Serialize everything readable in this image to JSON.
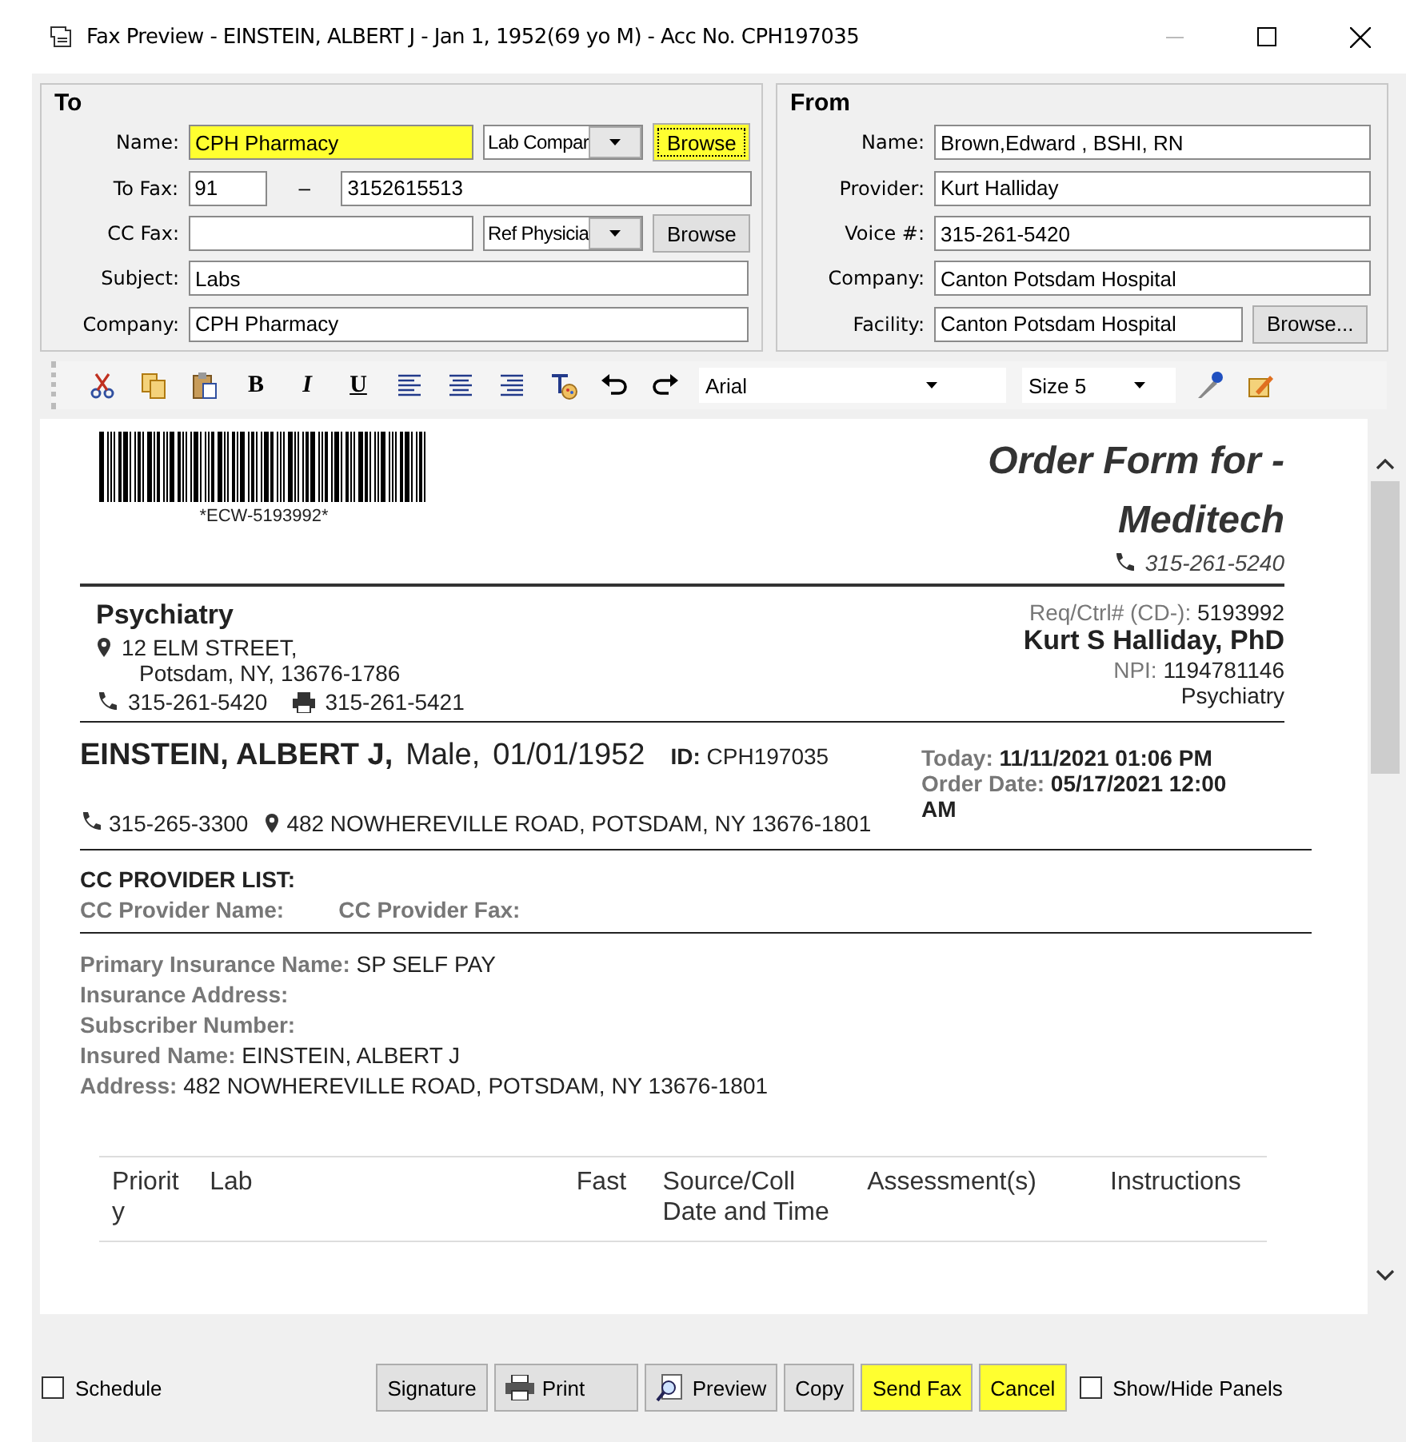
{
  "window": {
    "title": "Fax Preview - EINSTEIN, ALBERT J - Jan 1, 1952(69 yo M) - Acc No. CPH197035"
  },
  "to": {
    "legend": "To",
    "rows": [
      {
        "label": "Name:",
        "parts": [
          {
            "kind": "input",
            "value": "CPH Pharmacy",
            "highlighted": true
          },
          {
            "kind": "select",
            "value": "Lab Compar"
          },
          {
            "kind": "button",
            "label": "Browse",
            "highlighted": true
          }
        ]
      },
      {
        "label": "To Fax:",
        "parts": [
          {
            "kind": "input",
            "value": "91",
            "highlighted": false
          },
          {
            "kind": "dash",
            "text": "–"
          },
          {
            "kind": "input",
            "value": "3152615513",
            "highlighted": false
          }
        ]
      },
      {
        "label": "CC Fax:",
        "parts": [
          {
            "kind": "input",
            "highlighted": false
          },
          {
            "kind": "select",
            "value": "Ref Physicia"
          },
          {
            "kind": "button",
            "label": "Browse",
            "highlighted": false
          }
        ]
      },
      {
        "label": "Subject:",
        "parts": [
          {
            "kind": "input",
            "value": "Labs",
            "highlighted": false
          }
        ]
      },
      {
        "label": "Company:",
        "parts": [
          {
            "kind": "input",
            "value": "CPH Pharmacy",
            "highlighted": false
          }
        ]
      }
    ]
  },
  "from": {
    "legend": "From",
    "rows": [
      {
        "label": "Name:",
        "value": "Brown,Edward , BSHI, RN"
      },
      {
        "label": "Provider:",
        "value": "Kurt Halliday"
      },
      {
        "label": "Voice #:",
        "value": "315-261-5420"
      },
      {
        "label": "Company:",
        "value": "Canton Potsdam Hospital"
      },
      {
        "label": "Facility:",
        "value": "Canton Potsdam Hospital",
        "button": "Browse..."
      }
    ]
  },
  "toolbar": {
    "format_buttons": [
      "B",
      "I",
      "U"
    ],
    "font": "Arial",
    "size": "Size 5"
  },
  "document": {
    "barcode_text": "*ECW-5193992*",
    "title_lines": [
      "Order Form for -",
      "Meditech"
    ],
    "title_phone": "315-261-5240",
    "practice": {
      "name": "Psychiatry",
      "address_lines": [
        "12 ELM STREET,",
        "Potsdam, NY, 13676-1786"
      ],
      "phone": "315-261-5420",
      "fax": "315-261-5421"
    },
    "provider": {
      "req_label": "Req/Ctrl# (CD-):",
      "req_value": "5193992",
      "name": "Kurt S Halliday, PhD",
      "npi_label": "NPI:",
      "npi_value": "1194781146",
      "specialty": "Psychiatry"
    },
    "patient": {
      "name": "EINSTEIN, ALBERT J,",
      "sex": "Male,",
      "dob": "01/01/1952",
      "id_label": "ID:",
      "id_value": "CPH197035",
      "phone": "315-265-3300",
      "address": "482 NOWHEREVILLE ROAD, POTSDAM, NY 13676-1801"
    },
    "dates": [
      {
        "label": "Today:",
        "value": "11/11/2021  01:06 PM"
      },
      {
        "label": "Order Date:",
        "value": "05/17/2021  12:00 AM"
      }
    ],
    "cc_list": {
      "heading": "CC PROVIDER LIST:",
      "columns": [
        "CC Provider Name:",
        "CC Provider Fax:"
      ]
    },
    "insurance": [
      {
        "label": "Primary Insurance Name:",
        "value": "SP SELF PAY"
      },
      {
        "label": "Insurance Address:"
      },
      {
        "label": "Subscriber Number:"
      },
      {
        "label": "Insured Name:",
        "value": "EINSTEIN, ALBERT J"
      },
      {
        "label": "Address:",
        "value": "482 NOWHEREVILLE ROAD, POTSDAM, NY 13676-1801"
      }
    ],
    "table": {
      "columns": [
        "Priority",
        "Lab",
        "Fast",
        "Source/Coll Date and Time",
        "Assessment(s)",
        "Instructions"
      ]
    }
  },
  "bottom": {
    "schedule": {
      "label": "Schedule",
      "checked": false
    },
    "buttons": [
      {
        "label": "Signature",
        "kind": "plain",
        "highlighted": false
      },
      {
        "label": "Print",
        "kind": "print",
        "highlighted": false
      },
      {
        "label": "Preview",
        "kind": "preview",
        "highlighted": false
      },
      {
        "label": "Copy",
        "kind": "plain",
        "highlighted": false
      },
      {
        "label": "Send Fax",
        "kind": "plain",
        "highlighted": true
      },
      {
        "label": "Cancel",
        "kind": "plain",
        "highlighted": true
      }
    ],
    "panels": {
      "label": "Show/Hide Panels",
      "checked": false
    }
  }
}
